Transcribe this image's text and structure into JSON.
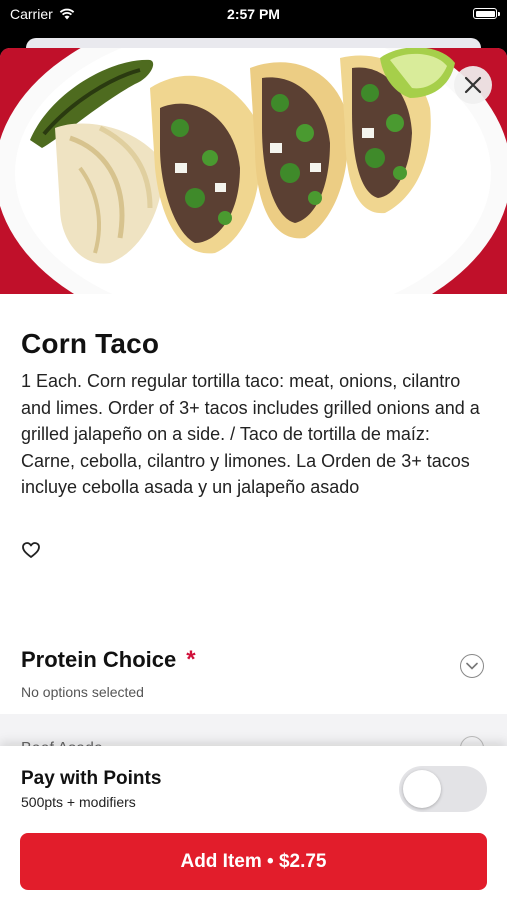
{
  "status_bar": {
    "carrier": "Carrier",
    "time": "2:57 PM"
  },
  "item": {
    "title": "Corn Taco",
    "description": "1 Each. Corn regular tortilla taco: meat, onions, cilantro and limes. Order of 3+ tacos includes grilled onions and a grilled jalapeño on a side. / Taco de tortilla de maíz: Carne, cebolla, cilantro y limones. La Orden de 3+ tacos incluye cebolla asada y un jalapeño asado"
  },
  "protein": {
    "title": "Protein Choice",
    "required_marker": "*",
    "subtitle": "No options selected"
  },
  "next_section": {
    "title": "Beef Asada"
  },
  "points": {
    "title": "Pay with Points",
    "subtitle": "500pts + modifiers",
    "enabled": false
  },
  "add_button": {
    "label": "Add Item • $2.75"
  },
  "colors": {
    "accent": "#e21d2b",
    "required": "#d0103a",
    "hero_background": "#c0102a"
  },
  "icons": {
    "close": "close-icon",
    "favorite": "heart-outline-icon",
    "expand": "chevron-down-icon",
    "wifi": "wifi-icon",
    "battery": "battery-icon"
  }
}
